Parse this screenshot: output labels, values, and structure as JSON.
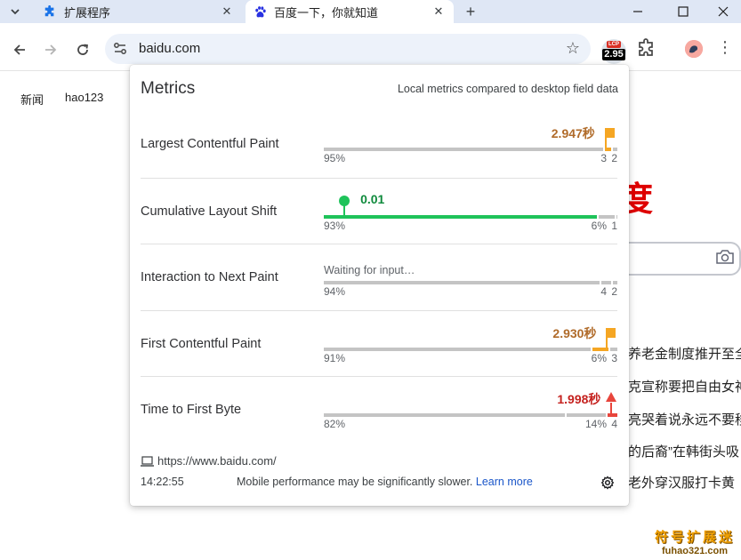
{
  "tabs": [
    {
      "title": "扩展程序",
      "icon": "puzzle-icon",
      "active": false
    },
    {
      "title": "百度一下，你就知道",
      "icon": "baidu-paw-icon",
      "active": true
    }
  ],
  "toolbar": {
    "url": "baidu.com",
    "extension_badge": "2.95",
    "extension_badge_label": "LCP"
  },
  "page": {
    "nav_links": [
      "新闻",
      "hao123"
    ],
    "logo_fragment": "度",
    "hot_items": [
      "养老金制度推开至全",
      "克宣称要把自由女神",
      "亮哭着说永远不要移",
      "的后裔”在韩街头吸",
      "老外穿汉服打卡黄"
    ],
    "watermark_title": "符号扩展迷",
    "watermark_url": "fuhao321.com"
  },
  "popup": {
    "title": "Metrics",
    "subtitle": "Local metrics compared to desktop field data",
    "metrics": [
      {
        "name": "Largest Contentful Paint",
        "value": "2.947秒",
        "value_color": "#b06b2a",
        "status": "needs-improvement",
        "good_pct": "95%",
        "mid_pct": "3",
        "poor_pct": "2",
        "good_fraction": 0.95,
        "mid_fraction": 0.03,
        "poor_fraction": 0.02,
        "marker_fraction": 0.96
      },
      {
        "name": "Cumulative Layout Shift",
        "value": "0.01",
        "value_color": "#0f8a3c",
        "status": "good",
        "good_pct": "93%",
        "mid_pct": "6%",
        "poor_pct": "1",
        "good_fraction": 0.93,
        "mid_fraction": 0.06,
        "poor_fraction": 0.01,
        "marker_fraction": 0.07
      },
      {
        "name": "Interaction to Next Paint",
        "value": "Waiting for input…",
        "value_color": "#5f6368",
        "status": "waiting",
        "good_pct": "94%",
        "mid_pct": "4",
        "poor_pct": "2",
        "good_fraction": 0.94,
        "mid_fraction": 0.04,
        "poor_fraction": 0.02
      },
      {
        "name": "First Contentful Paint",
        "value": "2.930秒",
        "value_color": "#b06b2a",
        "status": "needs-improvement",
        "good_pct": "91%",
        "mid_pct": "6%",
        "poor_pct": "3",
        "good_fraction": 0.91,
        "mid_fraction": 0.06,
        "poor_fraction": 0.03,
        "marker_fraction": 0.965
      },
      {
        "name": "Time to First Byte",
        "value": "1.998秒",
        "value_color": "#c5221f",
        "status": "poor",
        "good_pct": "82%",
        "mid_pct": "14%",
        "poor_pct": "4",
        "good_fraction": 0.82,
        "mid_fraction": 0.14,
        "poor_fraction": 0.04,
        "marker_fraction": 0.98
      }
    ],
    "page_url": "https://www.baidu.com/",
    "timestamp": "14:22:55",
    "note": "Mobile performance may be significantly slower.",
    "learn_more": "Learn more"
  },
  "colors": {
    "good": "#1ec35a",
    "needs_improvement": "#f5a623",
    "poor": "#e8453c",
    "track": "#c4c4c4"
  }
}
